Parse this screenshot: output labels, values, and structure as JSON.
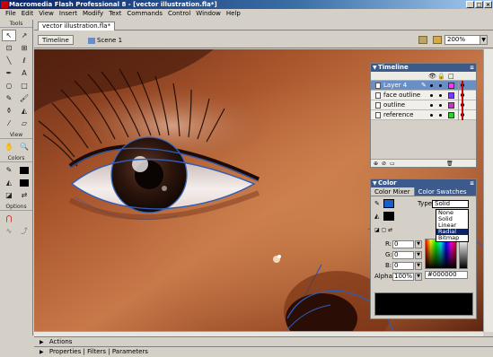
{
  "window": {
    "title": "Macromedia Flash Professional 8 - [vector illustration.fla*]",
    "buttons": [
      "_",
      "□",
      "×"
    ]
  },
  "menu": [
    "File",
    "Edit",
    "View",
    "Insert",
    "Modify",
    "Text",
    "Commands",
    "Control",
    "Window",
    "Help"
  ],
  "tools": {
    "title": "Tools",
    "view_label": "View",
    "colors_label": "Colors",
    "options_label": "Options",
    "stroke_color": "#000000",
    "fill_color": "#000000"
  },
  "document": {
    "tab": "vector illustration.fla*",
    "timeline_button": "Timeline",
    "scene": "Scene 1",
    "zoom": "200%"
  },
  "timeline": {
    "title": "Timeline",
    "layers": [
      {
        "name": "Layer 4",
        "color": "#ff33ff",
        "active": true
      },
      {
        "name": "face outline",
        "color": "#7a3cff",
        "active": false
      },
      {
        "name": "outline",
        "color": "#cc33cc",
        "active": false
      },
      {
        "name": "reference",
        "color": "#33cc33",
        "active": false
      }
    ]
  },
  "color_panel": {
    "title": "Color",
    "tab_mixer": "Color Mixer",
    "tab_swatches": "Color Swatches",
    "type_label": "Type:",
    "type_value": "Solid",
    "type_options": [
      "None",
      "Solid",
      "Linear",
      "Radial",
      "Bitmap"
    ],
    "type_highlighted": "Radial",
    "r_label": "R:",
    "r_value": "0",
    "g_label": "G:",
    "g_value": "0",
    "b_label": "B:",
    "b_value": "0",
    "alpha_label": "Alpha:",
    "alpha_value": "100%",
    "hex_value": "#000000",
    "stroke_swatch": "#1a5cc8",
    "fill_swatch": "#000000"
  },
  "bottom_panels": {
    "actions": "Actions",
    "properties": "Properties",
    "filters": "Filters",
    "parameters": "Parameters"
  }
}
